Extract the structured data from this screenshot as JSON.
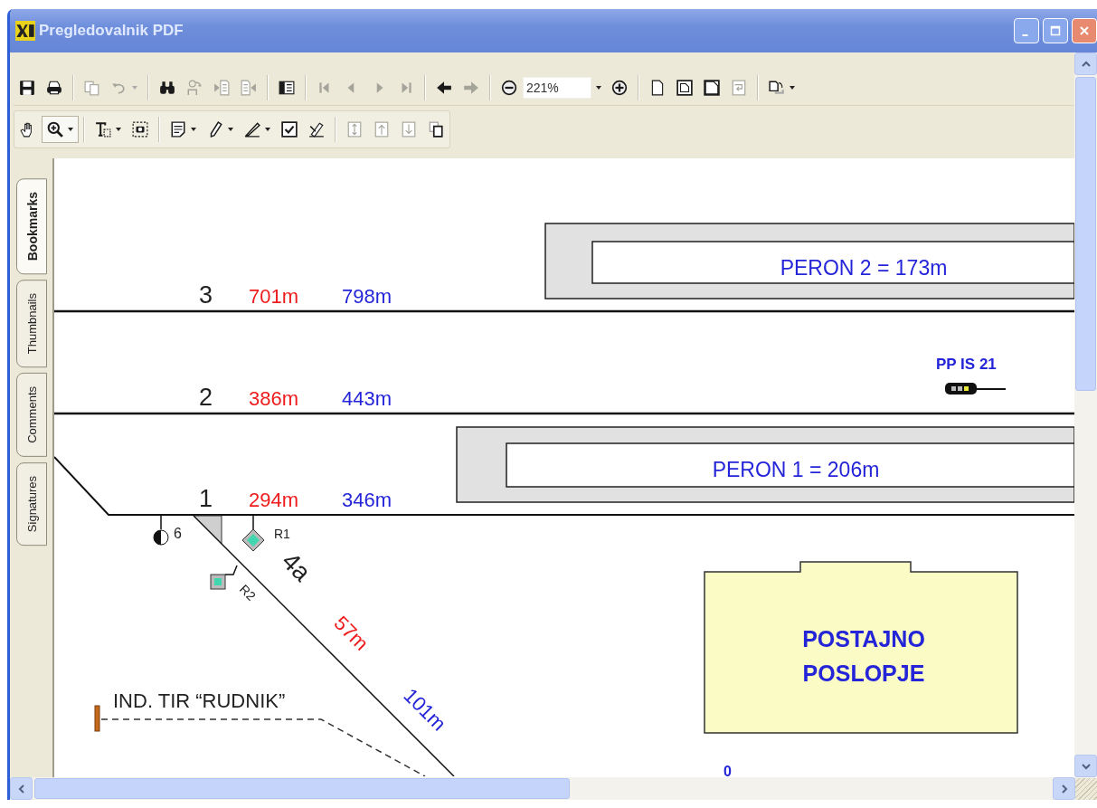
{
  "window": {
    "title": "Pregledovalnik PDF"
  },
  "toolbar_rows": [
    [
      {
        "kind": "save",
        "disabled": false
      },
      {
        "kind": "print",
        "disabled": false
      },
      {
        "kind": "separator"
      },
      {
        "kind": "copy",
        "disabled": true
      },
      {
        "kind": "undo",
        "disabled": true,
        "dropdown": true
      },
      {
        "kind": "separator"
      },
      {
        "kind": "find",
        "disabled": false
      },
      {
        "kind": "find-replace",
        "disabled": true
      },
      {
        "kind": "prev-doc",
        "disabled": true
      },
      {
        "kind": "next-doc",
        "disabled": true
      },
      {
        "kind": "separator"
      },
      {
        "kind": "panel",
        "disabled": false
      },
      {
        "kind": "separator"
      },
      {
        "kind": "first",
        "disabled": true
      },
      {
        "kind": "prev",
        "disabled": true
      },
      {
        "kind": "next",
        "disabled": true
      },
      {
        "kind": "last",
        "disabled": true
      },
      {
        "kind": "separator"
      },
      {
        "kind": "back",
        "disabled": false
      },
      {
        "kind": "forward",
        "disabled": true
      },
      {
        "kind": "separator"
      },
      {
        "kind": "zoom-out",
        "disabled": false
      },
      {
        "kind": "zoom-field",
        "value": "221%"
      },
      {
        "kind": "zoom-in",
        "disabled": false
      },
      {
        "kind": "separator"
      },
      {
        "kind": "actual-size",
        "disabled": false
      },
      {
        "kind": "fit-page",
        "disabled": false
      },
      {
        "kind": "fit-width",
        "disabled": false
      },
      {
        "kind": "reflow",
        "disabled": true
      },
      {
        "kind": "separator"
      },
      {
        "kind": "rotate",
        "disabled": false,
        "dropdown": true
      }
    ],
    [
      {
        "kind": "hand",
        "disabled": false,
        "selected": false
      },
      {
        "kind": "zoom-tool",
        "disabled": false,
        "selected": true,
        "dropdown": true
      },
      {
        "kind": "separator"
      },
      {
        "kind": "text-select",
        "disabled": false,
        "selected": false,
        "dropdown": true
      },
      {
        "kind": "snapshot",
        "disabled": false,
        "selected": false
      },
      {
        "kind": "separator"
      },
      {
        "kind": "note",
        "disabled": false,
        "selected": false,
        "dropdown": true
      },
      {
        "kind": "pencil",
        "disabled": false,
        "selected": false,
        "dropdown": true
      },
      {
        "kind": "pen",
        "disabled": false,
        "selected": false,
        "dropdown": true
      },
      {
        "kind": "stamp",
        "disabled": false,
        "selected": false
      },
      {
        "kind": "sign",
        "disabled": false,
        "selected": false
      },
      {
        "kind": "separator"
      },
      {
        "kind": "insert-pages",
        "disabled": true,
        "selected": false
      },
      {
        "kind": "extract-up",
        "disabled": true,
        "selected": false
      },
      {
        "kind": "extract-down",
        "disabled": true,
        "selected": false
      },
      {
        "kind": "copy-pages",
        "disabled": false,
        "selected": false
      }
    ]
  ],
  "side_tabs": [
    {
      "label": "Bookmarks",
      "selected": true
    },
    {
      "label": "Thumbnails",
      "selected": false
    },
    {
      "label": "Comments",
      "selected": false
    },
    {
      "label": "Signatures",
      "selected": false
    }
  ],
  "drawing": {
    "platforms": [
      {
        "label": "PERON 2 = 173m"
      },
      {
        "label": "PERON 1 = 206m"
      }
    ],
    "tracks": [
      {
        "number": "3",
        "length_1": "701m",
        "length_2": "798m"
      },
      {
        "number": "2",
        "length_1": "386m",
        "length_2": "443m"
      },
      {
        "number": "1",
        "length_1": "294m",
        "length_2": "346m"
      }
    ],
    "signal": {
      "label": "PP IS 21"
    },
    "markers": [
      "6",
      "R1",
      "R2"
    ],
    "branch": {
      "number": "4a",
      "length_1": "57m",
      "length_2": "101m"
    },
    "siding": "IND. TIR “RUDNIK”",
    "building": [
      "POSTAJNO",
      "POSLOPJE"
    ],
    "fragment": "0"
  }
}
